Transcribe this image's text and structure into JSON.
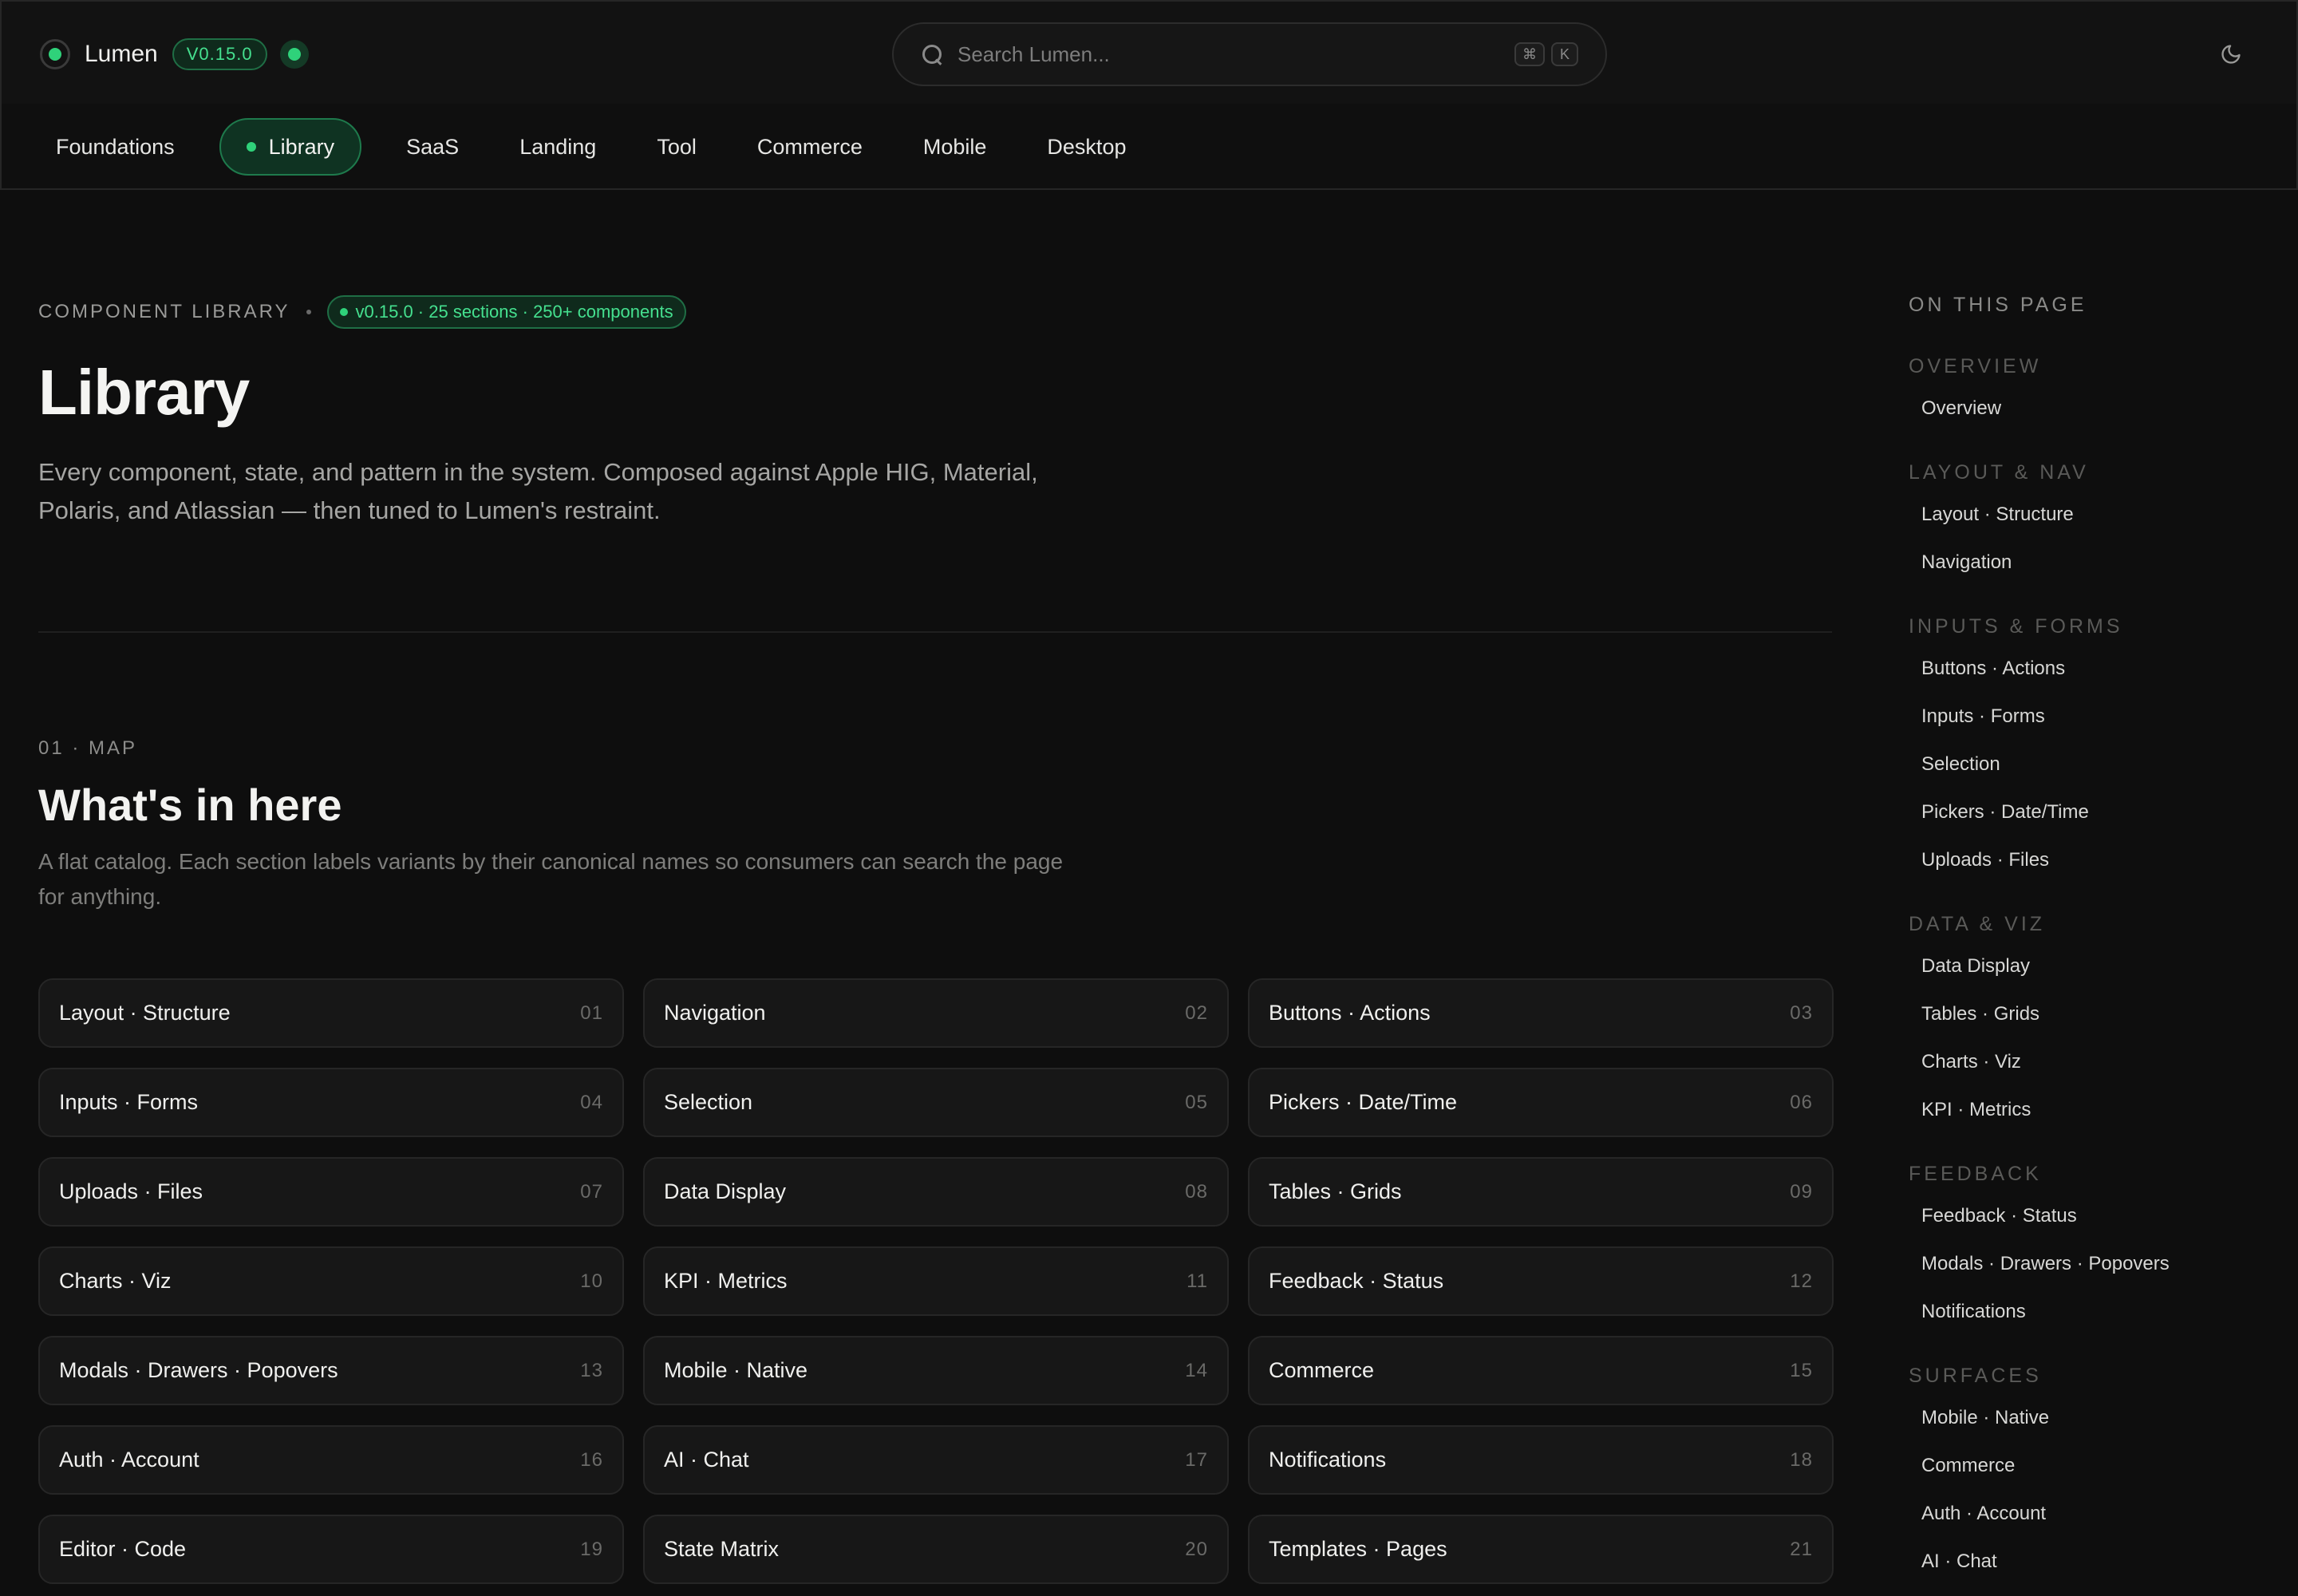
{
  "header": {
    "brand": "Lumen",
    "version": "V0.15.0",
    "search_placeholder": "Search Lumen...",
    "shortcut_keys": [
      "⌘",
      "K"
    ]
  },
  "nav": {
    "tabs": [
      {
        "label": "Foundations"
      },
      {
        "label": "Library"
      },
      {
        "label": "SaaS"
      },
      {
        "label": "Landing"
      },
      {
        "label": "Tool"
      },
      {
        "label": "Commerce"
      },
      {
        "label": "Mobile"
      },
      {
        "label": "Desktop"
      }
    ],
    "active": "Library"
  },
  "hero": {
    "eyebrow": "COMPONENT LIBRARY",
    "meta": "v0.15.0 · 25 sections · 250+ components",
    "title": "Library",
    "lede": "Every component, state, and pattern in the system. Composed against Apple HIG, Material, Polaris, and Atlassian — then tuned to Lumen's restraint."
  },
  "map": {
    "eyebrow": "01 · MAP",
    "title": "What's in here",
    "description": "A flat catalog. Each section labels variants by their canonical names so consumers can search the page for anything.",
    "cards": [
      {
        "title": "Layout · Structure",
        "num": "01"
      },
      {
        "title": "Navigation",
        "num": "02"
      },
      {
        "title": "Buttons · Actions",
        "num": "03"
      },
      {
        "title": "Inputs · Forms",
        "num": "04"
      },
      {
        "title": "Selection",
        "num": "05"
      },
      {
        "title": "Pickers · Date/Time",
        "num": "06"
      },
      {
        "title": "Uploads · Files",
        "num": "07"
      },
      {
        "title": "Data Display",
        "num": "08"
      },
      {
        "title": "Tables · Grids",
        "num": "09"
      },
      {
        "title": "Charts · Viz",
        "num": "10"
      },
      {
        "title": "KPI · Metrics",
        "num": "11"
      },
      {
        "title": "Feedback · Status",
        "num": "12"
      },
      {
        "title": "Modals · Drawers · Popovers",
        "num": "13"
      },
      {
        "title": "Mobile · Native",
        "num": "14"
      },
      {
        "title": "Commerce",
        "num": "15"
      },
      {
        "title": "Auth · Account",
        "num": "16"
      },
      {
        "title": "AI · Chat",
        "num": "17"
      },
      {
        "title": "Notifications",
        "num": "18"
      },
      {
        "title": "Editor · Code",
        "num": "19"
      },
      {
        "title": "State Matrix",
        "num": "20"
      },
      {
        "title": "Templates · Pages",
        "num": "21"
      }
    ]
  },
  "toc": {
    "heading": "ON THIS PAGE",
    "groups": [
      {
        "label": "OVERVIEW",
        "links": [
          "Overview"
        ]
      },
      {
        "label": "LAYOUT & NAV",
        "links": [
          "Layout · Structure",
          "Navigation"
        ]
      },
      {
        "label": "INPUTS & FORMS",
        "links": [
          "Buttons · Actions",
          "Inputs · Forms",
          "Selection",
          "Pickers · Date/Time",
          "Uploads · Files"
        ]
      },
      {
        "label": "DATA & VIZ",
        "links": [
          "Data Display",
          "Tables · Grids",
          "Charts · Viz",
          "KPI · Metrics"
        ]
      },
      {
        "label": "FEEDBACK",
        "links": [
          "Feedback · Status",
          "Modals · Drawers · Popovers",
          "Notifications"
        ]
      },
      {
        "label": "SURFACES",
        "links": [
          "Mobile · Native",
          "Commerce",
          "Auth · Account",
          "AI · Chat"
        ]
      }
    ]
  },
  "colors": {
    "accent": "#2fd27a",
    "background": "#0e0e0e",
    "card": "#171717"
  }
}
